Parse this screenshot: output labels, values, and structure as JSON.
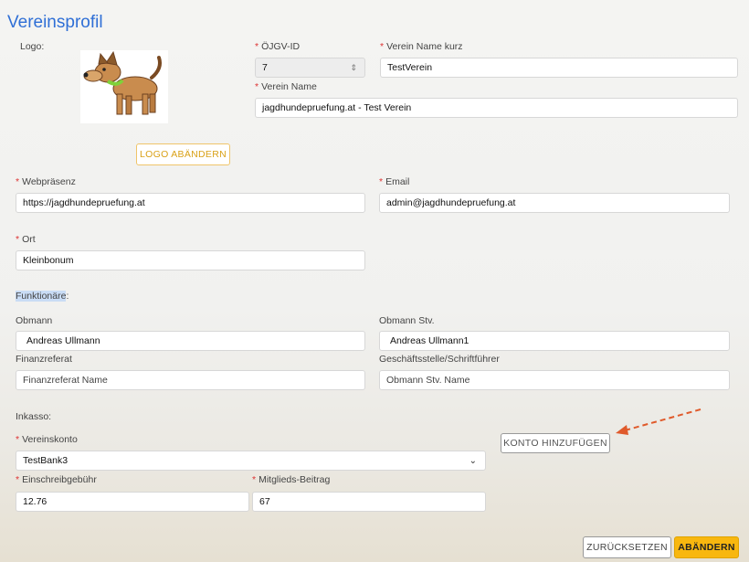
{
  "page_title": "Vereinsprofil",
  "logo": {
    "label": "Logo:",
    "change_button": "LOGO ABÄNDERN"
  },
  "ojgv_id": {
    "label": "ÖJGV-ID",
    "value": "7"
  },
  "verein_name_kurz": {
    "label": "Verein Name kurz",
    "value": "TestVerein"
  },
  "verein_name": {
    "label": "Verein Name",
    "value": "jagdhundepruefung.at - Test Verein"
  },
  "webpraesenz": {
    "label": "Webpräsenz",
    "value": "https://jagdhundepruefung.at"
  },
  "email": {
    "label": "Email",
    "value": "admin@jagdhundepruefung.at"
  },
  "ort": {
    "label": "Ort",
    "value": "Kleinbonum"
  },
  "funktionaere": {
    "heading_highlight": "Funktionäre",
    "heading_suffix": ":",
    "obmann": {
      "label": "Obmann",
      "value": "Andreas Ullmann"
    },
    "obmann_stv": {
      "label": "Obmann Stv.",
      "value": "Andreas Ullmann1"
    },
    "finanzreferat": {
      "label": "Finanzreferat",
      "placeholder": "Finanzreferat Name"
    },
    "geschaeftsstelle": {
      "label": "Geschäftsstelle/Schriftführer",
      "placeholder": "Obmann Stv. Name"
    }
  },
  "inkasso": {
    "heading": "Inkasso:",
    "vereinskonto": {
      "label": "Vereinskonto",
      "value": "TestBank3"
    },
    "konto_button": "KONTO HINZUFÜGEN",
    "einschreibgebuehr": {
      "label": "Einschreibgebühr",
      "value": "12.76"
    },
    "mitglieds_beitrag": {
      "label": "Mitglieds-Beitrag",
      "value": "67"
    }
  },
  "actions": {
    "reset": "ZURÜCKSETZEN",
    "save": "ABÄNDERN"
  },
  "required_marker": "*",
  "icons": {
    "spinner": "number-spinner-icon",
    "dropdown": "chevron-down-icon",
    "arrow": "dashed-arrow-icon",
    "logo": "dog-logo"
  },
  "colors": {
    "title": "#2f6fd6",
    "required": "#dd3333",
    "accent": "#f8b70f",
    "arrow": "#e05a2b"
  }
}
